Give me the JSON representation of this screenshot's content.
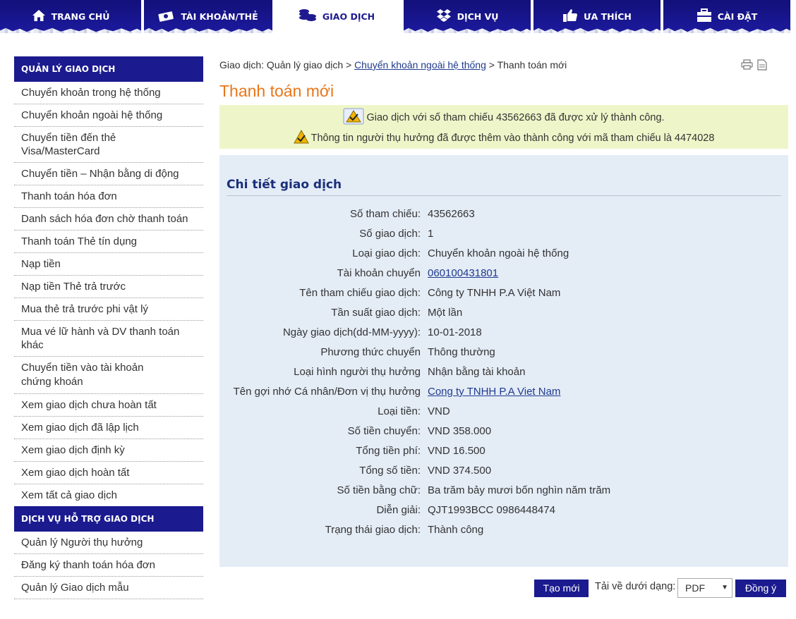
{
  "nav": {
    "tabs": [
      {
        "label": "TRANG CHỦ",
        "icon": "home-icon"
      },
      {
        "label": "TÀI KHOẢN/THẺ",
        "icon": "money-icon"
      },
      {
        "label": "GIAO DỊCH",
        "icon": "coins-icon",
        "active": true
      },
      {
        "label": "DỊCH VỤ",
        "icon": "dropbox-icon"
      },
      {
        "label": "ƯA THÍCH",
        "icon": "thumbs-up-icon"
      },
      {
        "label": "CÀI ĐẶT",
        "icon": "briefcase-icon"
      }
    ]
  },
  "sidebar": {
    "section1": {
      "title": "QUẢN LÝ GIAO DỊCH",
      "items": [
        "Chuyển khoản trong hệ thống",
        "Chuyển khoản ngoài hệ thống",
        "Chuyển tiền đến thẻ Visa/MasterCard",
        "Chuyển tiền – Nhận bằng di động",
        "Thanh toán hóa đơn",
        "Danh sách hóa đơn chờ thanh toán",
        "Thanh toán Thẻ tín dụng",
        "Nạp tiền",
        "Nạp tiền Thẻ trả trước",
        "Mua thẻ trả trước phi vật lý",
        "Mua vé lữ hành và DV thanh toán khác",
        "Chuyển tiền vào tài khoản chứng khoán",
        "Xem giao dịch chưa hoàn tất",
        "Xem giao dịch đã lập lịch",
        "Xem giao dịch định kỳ",
        "Xem giao dịch hoàn tất",
        "Xem tất cả giao dịch"
      ]
    },
    "section2": {
      "title": "DỊCH VỤ HỖ TRỢ GIAO DỊCH",
      "items": [
        "Quản lý Người thụ hưởng",
        "Đăng ký thanh toán hóa đơn",
        "Quản lý Giao dịch mẫu"
      ]
    }
  },
  "breadcrumb": {
    "part1": "Giao dịch: Quản lý giao dịch >",
    "link": "Chuyển khoản ngoài hệ thống",
    "part3": "> Thanh toán mới"
  },
  "page_title": "Thanh toán mới",
  "alerts": [
    "Giao dịch với số tham chiếu 43562663 đã được xử lý thành công.",
    "Thông tin người thụ hưởng đã được thêm vào thành công với mã tham chiếu là 4474028"
  ],
  "detail": {
    "title": "Chi tiết giao dịch",
    "rows": [
      {
        "label": "Số tham chiếu:",
        "value": "43562663"
      },
      {
        "label": "Số giao dịch:",
        "value": "1"
      },
      {
        "label": "Loại giao dịch:",
        "value": "Chuyển khoản ngoài hệ thống"
      },
      {
        "label": "Tài khoản chuyển",
        "value": "060100431801",
        "link": true
      },
      {
        "label": "Tên tham chiếu giao dịch:",
        "value": "Công ty TNHH P.A Việt Nam"
      },
      {
        "label": "Tần suất giao dịch:",
        "value": "Một lần"
      },
      {
        "label": "Ngày giao dịch(dd-MM-yyyy):",
        "value": "10-01-2018"
      },
      {
        "label": "Phương thức chuyển",
        "value": "Thông thường"
      },
      {
        "label": "Loại hình người thụ hưởng",
        "value": "Nhận bằng tài khoản"
      },
      {
        "label": "Tên gợi nhớ Cá nhân/Đơn vị thụ hưởng",
        "value": "Cong ty TNHH P.A Viet Nam",
        "link": true
      },
      {
        "label": "Loại tiền:",
        "value": "VND"
      },
      {
        "label": "Số tiền chuyển:",
        "value": "VND 358.000"
      },
      {
        "label": "Tổng tiền phí:",
        "value": "VND 16.500"
      },
      {
        "label": "Tổng số tiền:",
        "value": "VND 374.500"
      },
      {
        "label": "Số tiền bằng chữ:",
        "value": "Ba trăm bảy mươi bốn nghìn năm trăm"
      },
      {
        "label": "Diễn giải:",
        "value": "QJT1993BCC 0986448474"
      },
      {
        "label": "Trạng thái giao dịch:",
        "value": "Thành công"
      }
    ]
  },
  "actions": {
    "new_label": "Tạo mới",
    "download_label": "Tải về dưới dạng:",
    "format_value": "PDF",
    "confirm_label": "Đồng ý"
  }
}
